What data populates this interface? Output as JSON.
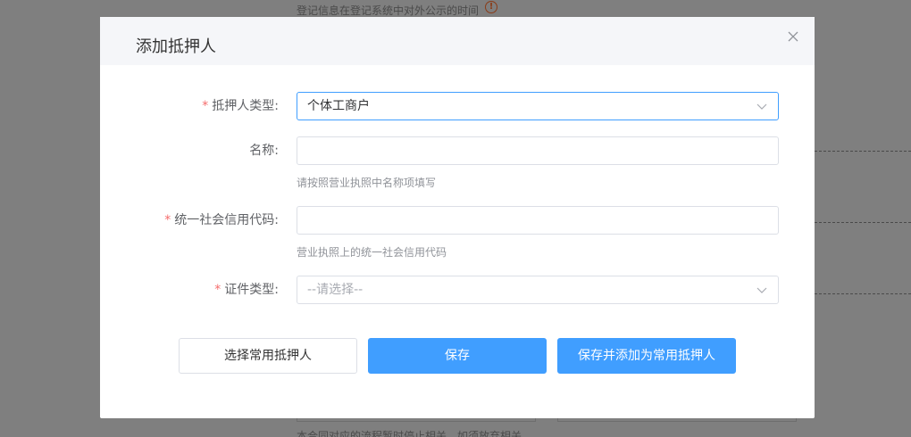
{
  "background": {
    "top_text": "登记信息在登记系统中对外公示的时间",
    "bottom_text": "本合同对应的流程暂时停止相关，如须放弃相关"
  },
  "modal": {
    "title": "添加抵押人",
    "fields": {
      "mortgagor_type": {
        "label": "抵押人类型:",
        "value": "个体工商户",
        "required": true
      },
      "name": {
        "label": "名称:",
        "value": "",
        "hint": "请按照营业执照中名称项填写",
        "required": false
      },
      "credit_code": {
        "label": "统一社会信用代码:",
        "value": "",
        "hint": "营业执照上的统一社会信用代码",
        "required": true
      },
      "id_type": {
        "label": "证件类型:",
        "placeholder": "--请选择--",
        "required": true
      }
    },
    "buttons": {
      "select_common": "选择常用抵押人",
      "save": "保存",
      "save_and_add": "保存并添加为常用抵押人"
    },
    "required_mark": "*"
  },
  "colors": {
    "primary": "#409eff",
    "required": "#f56c6c",
    "overlay": "#7f7f7f"
  }
}
